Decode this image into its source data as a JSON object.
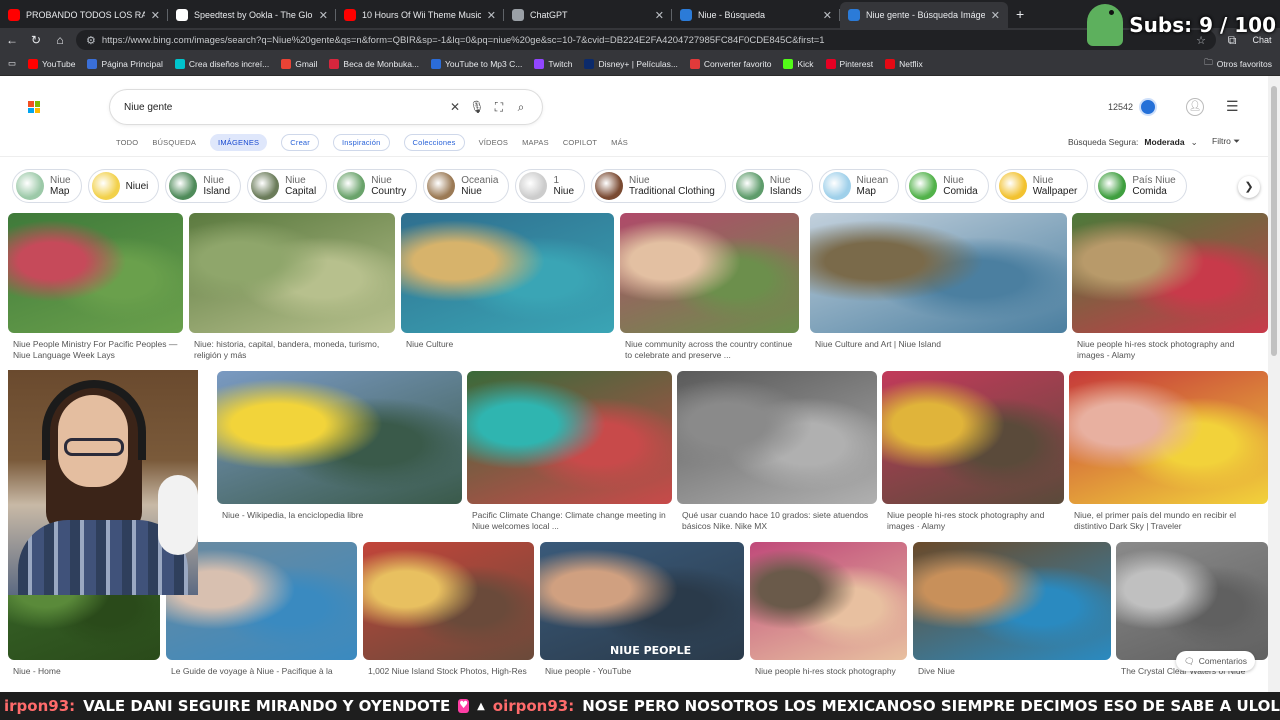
{
  "tabs": [
    {
      "title": "PROBANDO TODOS LOS RAMEN",
      "color": "#ff0000",
      "active": false
    },
    {
      "title": "Speedtest by Ookla - The Global B",
      "color": "#ffffff",
      "active": false
    },
    {
      "title": "10 Hours Of Wii Theme Music",
      "color": "#ff0000",
      "active": false
    },
    {
      "title": "ChatGPT",
      "color": "#9aa0a6",
      "active": false
    },
    {
      "title": "Niue - Búsqueda",
      "color": "#2b7bd8",
      "active": false
    },
    {
      "title": "Niue gente - Búsqueda Imágenes",
      "color": "#2b7bd8",
      "active": true
    }
  ],
  "browser": {
    "url": "https://www.bing.com/images/search?q=Niue%20gente&qs=n&form=QBIR&sp=-1&lq=0&pq=niue%20ge&sc=10-7&cvid=DB224E2FA4204727985FC84F0CDE845C&first=1",
    "profile_label": "Chat"
  },
  "bookmarks": [
    {
      "label": "YouTube",
      "color": "#ff0000"
    },
    {
      "label": "Página Principal",
      "color": "#3a6fd8"
    },
    {
      "label": "Crea diseños increí...",
      "color": "#00c4cc"
    },
    {
      "label": "Gmail",
      "color": "#ea4335"
    },
    {
      "label": "Beca de Monbuka...",
      "color": "#d7263d"
    },
    {
      "label": "YouTube to Mp3 C...",
      "color": "#2b6cd8"
    },
    {
      "label": "Twitch",
      "color": "#9146ff"
    },
    {
      "label": "Disney+ | Películas...",
      "color": "#0b2a6b"
    },
    {
      "label": "Converter favorito",
      "color": "#e03a3a"
    },
    {
      "label": "Kick",
      "color": "#53fc18"
    },
    {
      "label": "Pinterest",
      "color": "#e60023"
    },
    {
      "label": "Netflix",
      "color": "#e50914"
    }
  ],
  "other_bookmarks": "Otros favoritos",
  "overlay": {
    "subs_text": "Subs: 9 / 100"
  },
  "search": {
    "query": "Niue gente"
  },
  "rewards": {
    "points": "12542"
  },
  "scopes": [
    {
      "label": "TODO",
      "style": "plain"
    },
    {
      "label": "BÚSQUEDA",
      "style": "plain"
    },
    {
      "label": "IMÁGENES",
      "style": "active"
    },
    {
      "label": "Crear",
      "style": "pill"
    },
    {
      "label": "Inspiración",
      "style": "pill"
    },
    {
      "label": "Colecciones",
      "style": "pill"
    },
    {
      "label": "VÍDEOS",
      "style": "plain"
    },
    {
      "label": "MAPAS",
      "style": "plain"
    },
    {
      "label": "COPILOT",
      "style": "plain"
    },
    {
      "label": "MÁS",
      "style": "plain"
    }
  ],
  "safe_search": {
    "label": "Búsqueda Segura:",
    "value": "Moderada"
  },
  "filter_label": "Filtro",
  "chips": [
    {
      "l1": "Niue",
      "l2": "Map",
      "color": "#9cc9a8"
    },
    {
      "l1": "",
      "l2": "Niuei",
      "color": "#f2d14b"
    },
    {
      "l1": "Niue",
      "l2": "Island",
      "color": "#4f8b5a"
    },
    {
      "l1": "Niue",
      "l2": "Capital",
      "color": "#6b7c5a"
    },
    {
      "l1": "Niue",
      "l2": "Country",
      "color": "#6aa36b"
    },
    {
      "l1": "Oceania",
      "l2": "Niue",
      "color": "#9b7a55"
    },
    {
      "l1": "1",
      "l2": "Niue",
      "color": "#cccccc"
    },
    {
      "l1": "Niue",
      "l2": "Traditional Clothing",
      "color": "#7a4a32"
    },
    {
      "l1": "Niue",
      "l2": "Islands",
      "color": "#5e9c6b"
    },
    {
      "l1": "Niuean",
      "l2": "Map",
      "color": "#9fd0ea"
    },
    {
      "l1": "Niue",
      "l2": "Comida",
      "color": "#52b24a"
    },
    {
      "l1": "Niue",
      "l2": "Wallpaper",
      "color": "#f2c230"
    },
    {
      "l1": "País Niue",
      "l2": "Comida",
      "color": "#3f9f3f"
    }
  ],
  "results": [
    {
      "caption": "Niue People Ministry For Pacific Peoples — Niue Language Week Lays",
      "colors": [
        "#3f7a3a",
        "#c64a5a",
        "#6aa04c"
      ]
    },
    {
      "caption": "Niue: historia, capital, bandera, moneda, turismo, religión y más",
      "colors": [
        "#5b7a3f",
        "#8fa66b",
        "#b7c08d"
      ]
    },
    {
      "caption": "Niue Culture",
      "colors": [
        "#2f6f8f",
        "#d7b36b",
        "#3aa5b5"
      ]
    },
    {
      "caption": "Niue community across the country continue to celebrate and preserve ...",
      "colors": [
        "#b04a6a",
        "#e3c0a2",
        "#6c8f4c"
      ]
    },
    {
      "caption": "Niue Culture and Art | Niue Island",
      "colors": [
        "#c2d0dc",
        "#7a6a4a",
        "#4b7fa0"
      ]
    },
    {
      "caption": "Niue people hi-res stock photography and images - Alamy",
      "colors": [
        "#4c7a3a",
        "#b89a6a",
        "#c83a4a"
      ]
    },
    {
      "caption": "Niue - Wikipedia, la enciclopedia libre",
      "colors": [
        "#7a9ac2",
        "#f2d43a",
        "#3a5a4a"
      ]
    },
    {
      "caption": "Pacific Climate Change: Climate change meeting in Niue welcomes local ...",
      "colors": [
        "#3a6a3a",
        "#2fb5b0",
        "#c84a4a"
      ]
    },
    {
      "caption": "Qué usar cuando hace 10 grados: siete atuendos básicos Nike. Nike MX",
      "colors": [
        "#5a5a5a",
        "#8a8a8a",
        "#b0b0b0"
      ]
    },
    {
      "caption": "Niue people hi-res stock photography and images · Alamy",
      "colors": [
        "#c23a5a",
        "#e0b43a",
        "#5a4a3a"
      ]
    },
    {
      "caption": "Niue, el primer país del mundo en recibir el distintivo Dark Sky | Traveler",
      "colors": [
        "#c63a3a",
        "#e8b0a0",
        "#f2d23a"
      ]
    },
    {
      "caption": "Niue - Home",
      "colors": [
        "#3a6a2a",
        "#5a8a3a",
        "#2a4a1a"
      ]
    },
    {
      "caption": "Le Guide de voyage à Niue - Pacifique à la",
      "colors": [
        "#6a8aa0",
        "#d8c0b0",
        "#3a8ac0"
      ]
    },
    {
      "caption": "1,002 Niue Island Stock Photos, High-Res",
      "colors": [
        "#c2453a",
        "#e8c060",
        "#6a4a3a"
      ]
    },
    {
      "caption": "Niue people - YouTube",
      "colors": [
        "#3a5a7a",
        "#d0a080",
        "#2a3a4a"
      ]
    },
    {
      "caption": "Niue people hi-res stock photography",
      "colors": [
        "#c04a7a",
        "#6a5a4a",
        "#e8c0a0"
      ]
    },
    {
      "caption": "Dive Niue",
      "colors": [
        "#6a4a2a",
        "#c8905a",
        "#2a8ac0"
      ]
    },
    {
      "caption": "The Crystal Clear Waters of Niue",
      "colors": [
        "#8a8a8a",
        "#c0c0c0",
        "#606060"
      ]
    }
  ],
  "badge_niue_people": "NIUE PEOPLE",
  "feedback_label": "Comentarios",
  "chat": {
    "user1": "irpon93:",
    "msg1": "VALE DANI SEGUIRE MIRANDO Y OYENDOTE",
    "user2": "oirpon93:",
    "msg2": "NOSE PERO NOSOTROS LOS MEXICANOSO SIEMPRE DECIMOS ESO DE SABE A ULOL"
  }
}
